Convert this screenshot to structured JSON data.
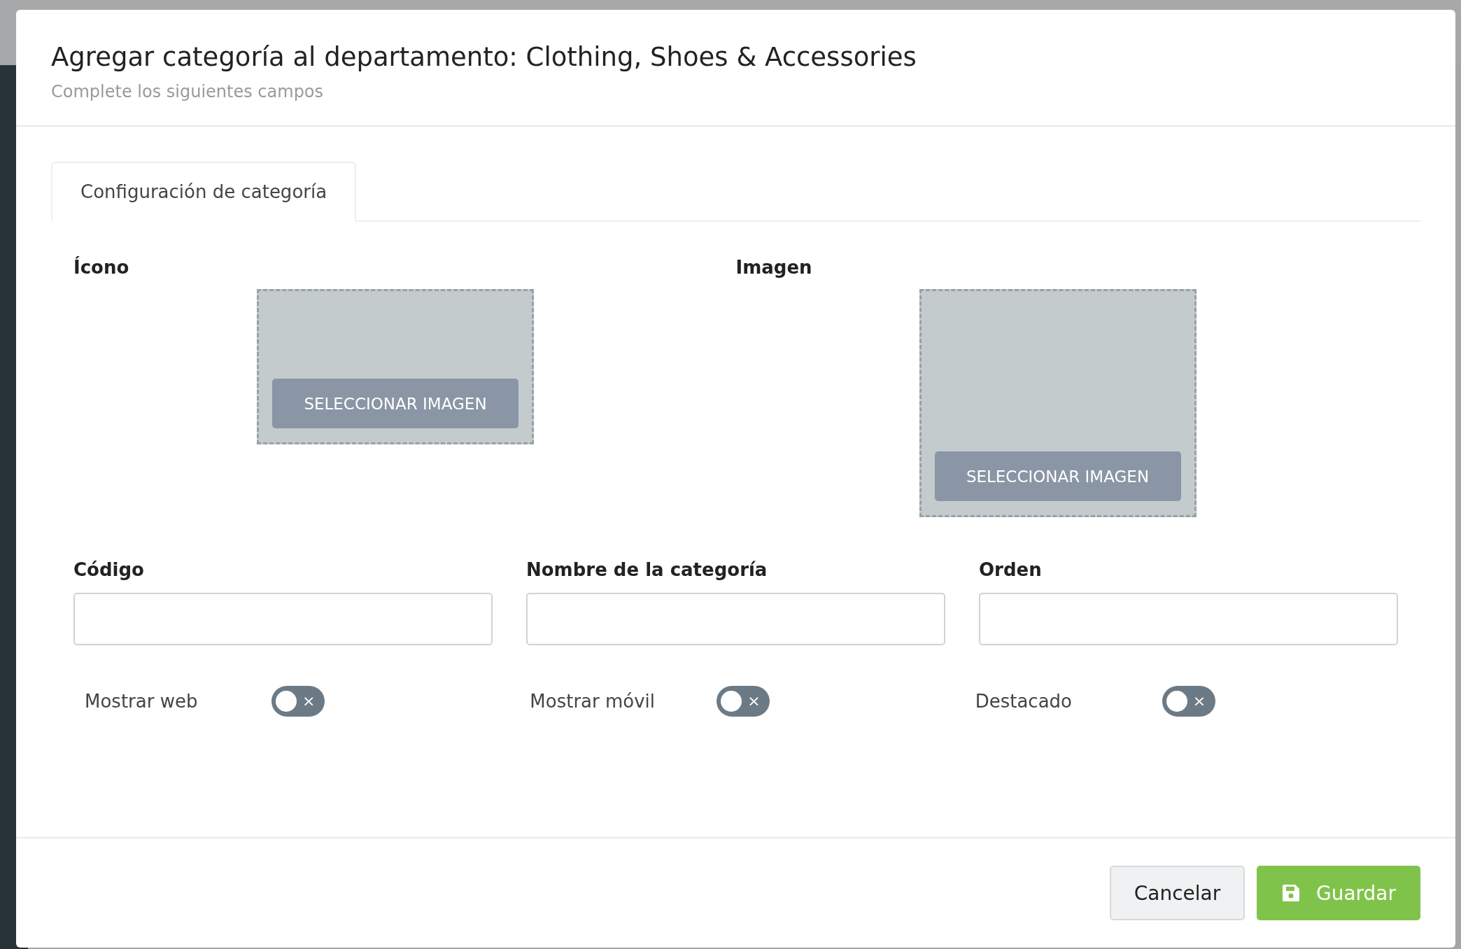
{
  "modal": {
    "title": "Agregar categoría al departamento: Clothing, Shoes & Accessories",
    "subtitle": "Complete los siguientes campos"
  },
  "tabs": [
    {
      "label": "Configuración de categoría",
      "selected": true
    }
  ],
  "uploads": [
    {
      "label": "Ícono",
      "button": "SELECCIONAR IMAGEN",
      "kind": "icon"
    },
    {
      "label": "Imagen",
      "button": "SELECCIONAR IMAGEN",
      "kind": "image"
    }
  ],
  "fields": [
    {
      "label": "Código"
    },
    {
      "label": "Nombre de la categoría"
    },
    {
      "label": "Orden"
    }
  ],
  "toggles": [
    {
      "label": "Mostrar web",
      "on": false,
      "symbol": "×"
    },
    {
      "label": "Mostrar móvil",
      "on": false,
      "symbol": "×"
    },
    {
      "label": "Destacado",
      "on": false,
      "symbol": "×"
    }
  ],
  "buttons": [
    {
      "label": "Cancelar",
      "kind": "secondary"
    },
    {
      "label": "Guardar",
      "kind": "primary"
    }
  ]
}
